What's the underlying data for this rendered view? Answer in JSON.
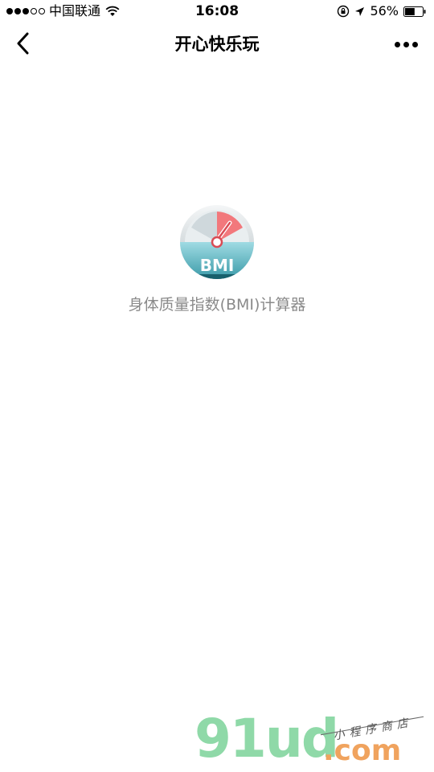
{
  "status_bar": {
    "carrier": "中国联通",
    "time": "16:08",
    "battery_percent": "56%",
    "battery_level": 0.56,
    "signal_bars_filled": 3,
    "signal_bars_total": 5,
    "icons": [
      "wifi-icon",
      "rotation-lock-icon",
      "location-arrow-icon",
      "battery-icon"
    ]
  },
  "nav_bar": {
    "title": "开心快乐玩",
    "back_icon": "chevron-left-icon",
    "more_icon": "more-dots-icon"
  },
  "app": {
    "name": "身体质量指数(BMI)计算器",
    "icon_label": "BMI",
    "icon": "bmi-gauge-icon",
    "colors": {
      "dial_red": "#f2787c",
      "dial_face": "#e9eef0",
      "teal_top": "#8fd3dc",
      "teal_bottom": "#3a9aa8",
      "needle": "#d94c55"
    }
  },
  "watermark": {
    "brand": "91ud",
    "suffix": ".com",
    "tagline": "小程序商店",
    "colors": {
      "brand": "#8fd9a8",
      "suffix": "#f0a35e"
    }
  }
}
